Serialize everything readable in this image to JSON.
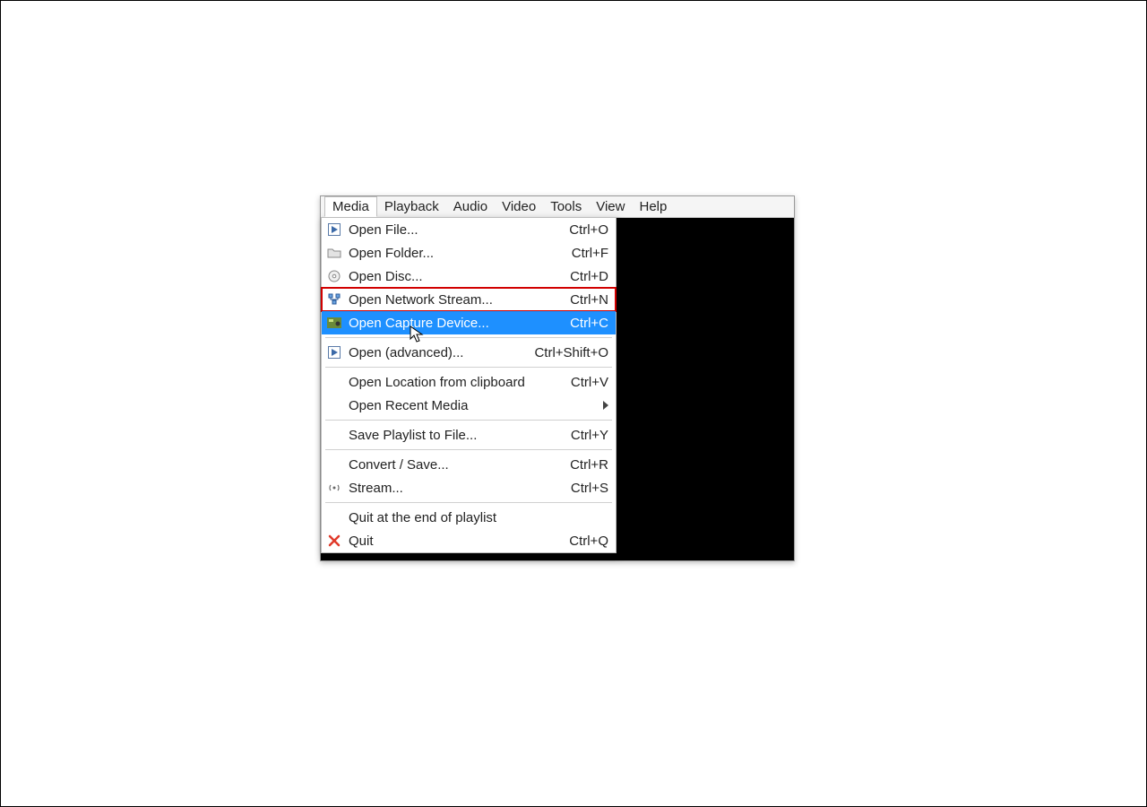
{
  "menubar": {
    "items": [
      "Media",
      "Playback",
      "Audio",
      "Video",
      "Tools",
      "View",
      "Help"
    ],
    "active_index": 0
  },
  "media_menu": {
    "open_file": {
      "label": "Open File...",
      "shortcut": "Ctrl+O"
    },
    "open_folder": {
      "label": "Open Folder...",
      "shortcut": "Ctrl+F"
    },
    "open_disc": {
      "label": "Open Disc...",
      "shortcut": "Ctrl+D"
    },
    "open_network": {
      "label": "Open Network Stream...",
      "shortcut": "Ctrl+N"
    },
    "open_capture": {
      "label": "Open Capture Device...",
      "shortcut": "Ctrl+C"
    },
    "open_advanced": {
      "label": "Open (advanced)...",
      "shortcut": "Ctrl+Shift+O"
    },
    "open_clipboard": {
      "label": "Open Location from clipboard",
      "shortcut": "Ctrl+V"
    },
    "open_recent": {
      "label": "Open Recent Media",
      "shortcut": ""
    },
    "save_playlist": {
      "label": "Save Playlist to File...",
      "shortcut": "Ctrl+Y"
    },
    "convert_save": {
      "label": "Convert / Save...",
      "shortcut": "Ctrl+R"
    },
    "stream": {
      "label": "Stream...",
      "shortcut": "Ctrl+S"
    },
    "quit_end": {
      "label": "Quit at the end of playlist",
      "shortcut": ""
    },
    "quit": {
      "label": "Quit",
      "shortcut": "Ctrl+Q"
    }
  },
  "state": {
    "highlighted_item": "open_capture",
    "red_boxed_item": "open_network"
  }
}
